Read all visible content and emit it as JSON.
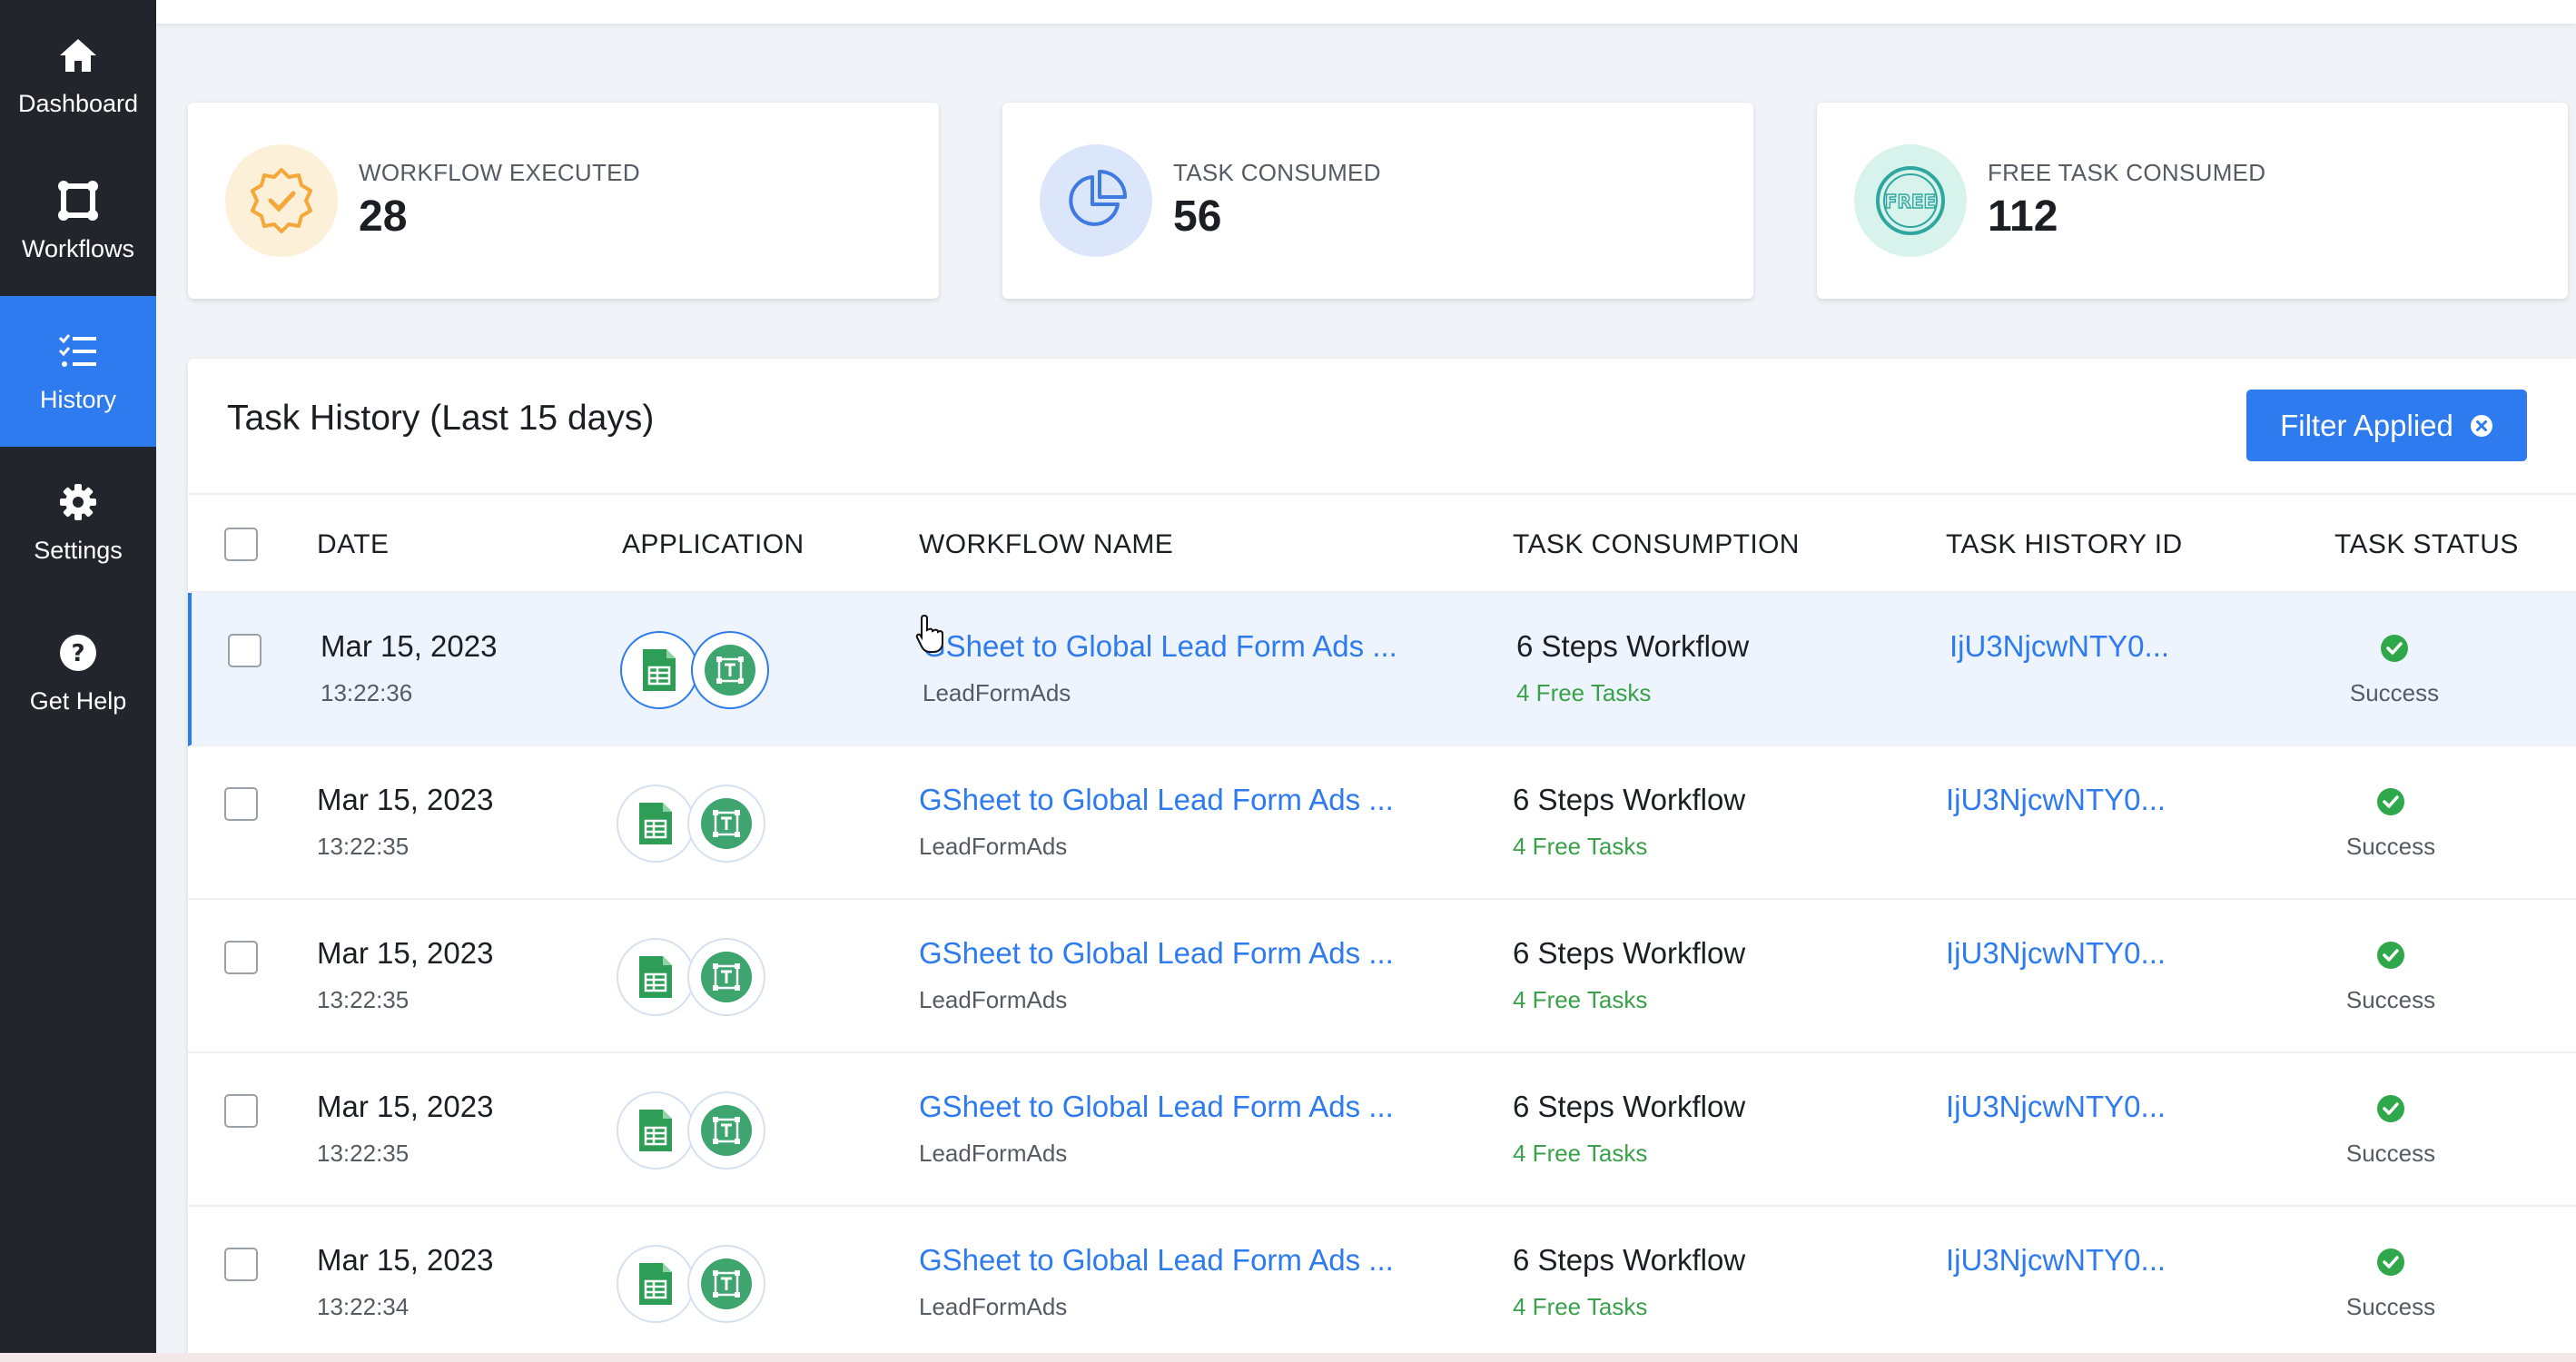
{
  "sidebar": {
    "items": [
      {
        "label": "Dashboard",
        "icon": "home-icon",
        "active": false
      },
      {
        "label": "Workflows",
        "icon": "workflow-icon",
        "active": false
      },
      {
        "label": "History",
        "icon": "history-list-icon",
        "active": true
      },
      {
        "label": "Settings",
        "icon": "gear-icon",
        "active": false
      },
      {
        "label": "Get Help",
        "icon": "help-icon",
        "active": false
      }
    ]
  },
  "stats": [
    {
      "label": "WORKFLOW EXECUTED",
      "value": "28",
      "icon": "badge-check-icon",
      "color": "#f4a83a",
      "bg": "#fdf0d8"
    },
    {
      "label": "TASK CONSUMED",
      "value": "56",
      "icon": "pie-chart-icon",
      "color": "#3f7ae0",
      "bg": "#dbe6fb"
    },
    {
      "label": "FREE TASK CONSUMED",
      "value": "112",
      "icon": "free-badge-icon",
      "color": "#2fa7a0",
      "bg": "#d8f2ec"
    }
  ],
  "panel": {
    "title": "Task History (Last 15 days)",
    "filter_label": "Filter Applied"
  },
  "table": {
    "headers": {
      "date": "DATE",
      "application": "APPLICATION",
      "workflow_name": "WORKFLOW NAME",
      "task_consumption": "TASK CONSUMPTION",
      "task_history_id": "TASK HISTORY ID",
      "task_status": "TASK STATUS"
    },
    "rows": [
      {
        "date": "Mar 15, 2023",
        "time": "13:22:36",
        "workflow": "GSheet to Global Lead Form Ads ...",
        "sub": "LeadFormAds",
        "steps": "6 Steps Workflow",
        "free": "4 Free Tasks",
        "id": "IjU3NjcwNTY0...",
        "status": "Success"
      },
      {
        "date": "Mar 15, 2023",
        "time": "13:22:35",
        "workflow": "GSheet to Global Lead Form Ads ...",
        "sub": "LeadFormAds",
        "steps": "6 Steps Workflow",
        "free": "4 Free Tasks",
        "id": "IjU3NjcwNTY0...",
        "status": "Success"
      },
      {
        "date": "Mar 15, 2023",
        "time": "13:22:35",
        "workflow": "GSheet to Global Lead Form Ads ...",
        "sub": "LeadFormAds",
        "steps": "6 Steps Workflow",
        "free": "4 Free Tasks",
        "id": "IjU3NjcwNTY0...",
        "status": "Success"
      },
      {
        "date": "Mar 15, 2023",
        "time": "13:22:35",
        "workflow": "GSheet to Global Lead Form Ads ...",
        "sub": "LeadFormAds",
        "steps": "6 Steps Workflow",
        "free": "4 Free Tasks",
        "id": "IjU3NjcwNTY0...",
        "status": "Success"
      },
      {
        "date": "Mar 15, 2023",
        "time": "13:22:34",
        "workflow": "GSheet to Global Lead Form Ads ...",
        "sub": "LeadFormAds",
        "steps": "6 Steps Workflow",
        "free": "4 Free Tasks",
        "id": "IjU3NjcwNTY0...",
        "status": "Success"
      }
    ]
  },
  "colors": {
    "sidebar_bg": "#22262c",
    "accent": "#2e7bf0",
    "success": "#2ea84a",
    "free_tasks_text": "#3aa14a"
  }
}
